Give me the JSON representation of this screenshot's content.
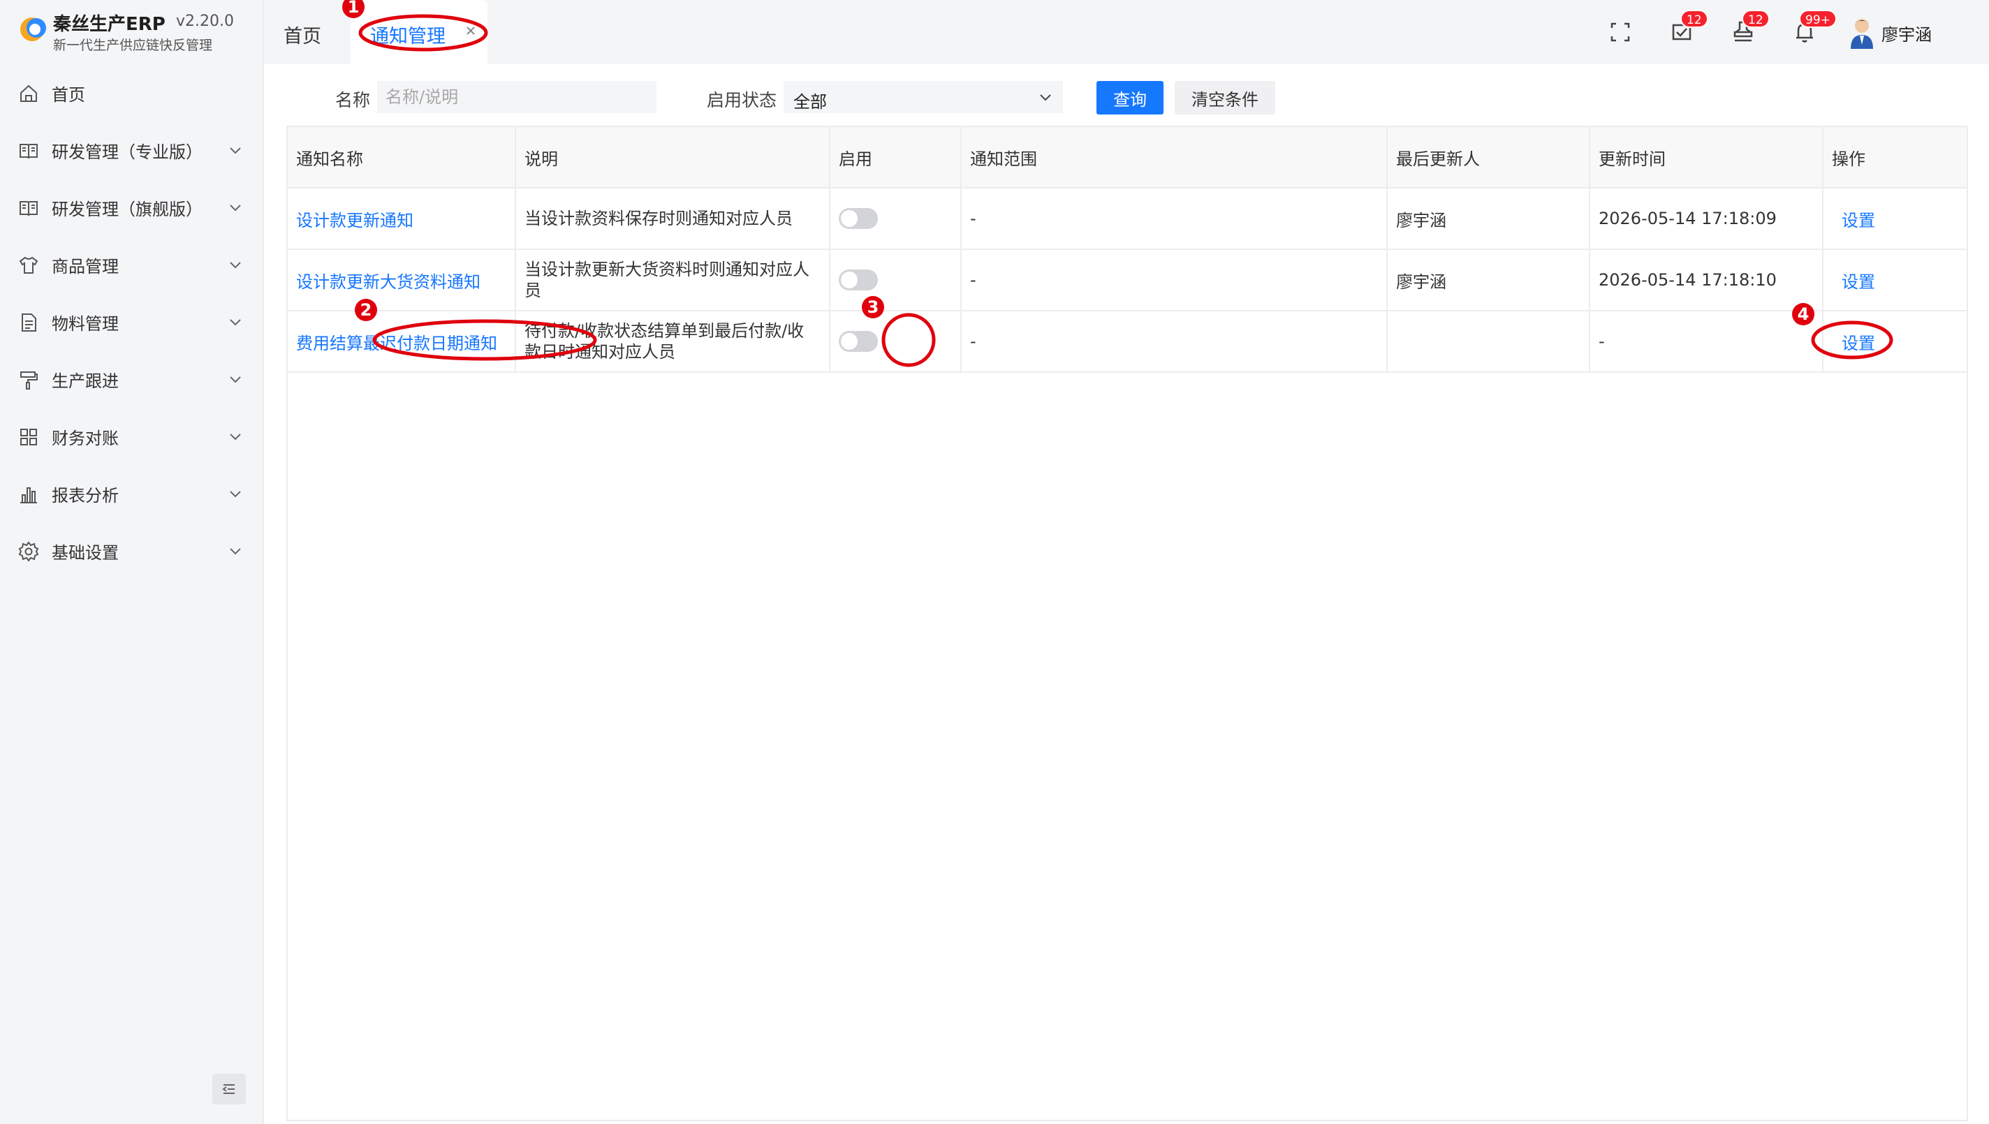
{
  "app": {
    "name": "秦丝生产ERP",
    "version": "v2.20.0",
    "subtitle": "新一代生产供应链快反管理"
  },
  "sidebar": {
    "items": [
      {
        "label": "首页",
        "icon": "home-icon"
      },
      {
        "label": "研发管理（专业版）",
        "icon": "book-icon"
      },
      {
        "label": "研发管理（旗舰版）",
        "icon": "book-icon"
      },
      {
        "label": "商品管理",
        "icon": "shirt-icon"
      },
      {
        "label": "物料管理",
        "icon": "document-icon"
      },
      {
        "label": "生产跟进",
        "icon": "paint-roller-icon"
      },
      {
        "label": "财务对账",
        "icon": "grid-icon"
      },
      {
        "label": "报表分析",
        "icon": "bar-chart-icon"
      },
      {
        "label": "基础设置",
        "icon": "gear-icon"
      }
    ]
  },
  "tabs": [
    {
      "label": "首页",
      "active": false
    },
    {
      "label": "通知管理",
      "active": true
    }
  ],
  "header": {
    "badges": {
      "todo": "12",
      "approval": "12",
      "notifications": "99+"
    },
    "user_name": "廖宇涵"
  },
  "filters": {
    "name_label": "名称",
    "name_placeholder": "名称/说明",
    "status_label": "启用状态",
    "status_value": "全部",
    "query_button": "查询",
    "clear_button": "清空条件"
  },
  "table": {
    "columns": [
      "通知名称",
      "说明",
      "启用",
      "通知范围",
      "最后更新人",
      "更新时间",
      "操作"
    ],
    "rows": [
      {
        "name": "设计款更新通知",
        "description": "当设计款资料保存时则通知对应人员",
        "enabled": false,
        "scope": "-",
        "updated_by": "廖宇涵",
        "updated_at": "2026-05-14 17:18:09",
        "action": "设置"
      },
      {
        "name": "设计款更新大货资料通知",
        "description": "当设计款更新大货资料时则通知对应人员",
        "enabled": false,
        "scope": "-",
        "updated_by": "廖宇涵",
        "updated_at": "2026-05-14 17:18:10",
        "action": "设置"
      },
      {
        "name": "费用结算最迟付款日期通知",
        "description": "待付款/收款状态结算单到最后付款/收款日时通知对应人员",
        "enabled": false,
        "scope": "-",
        "updated_by": "",
        "updated_at": "-",
        "action": "设置"
      }
    ]
  },
  "annotations": {
    "color": "#e0000d",
    "numbers": [
      "1",
      "2",
      "3",
      "4"
    ]
  }
}
